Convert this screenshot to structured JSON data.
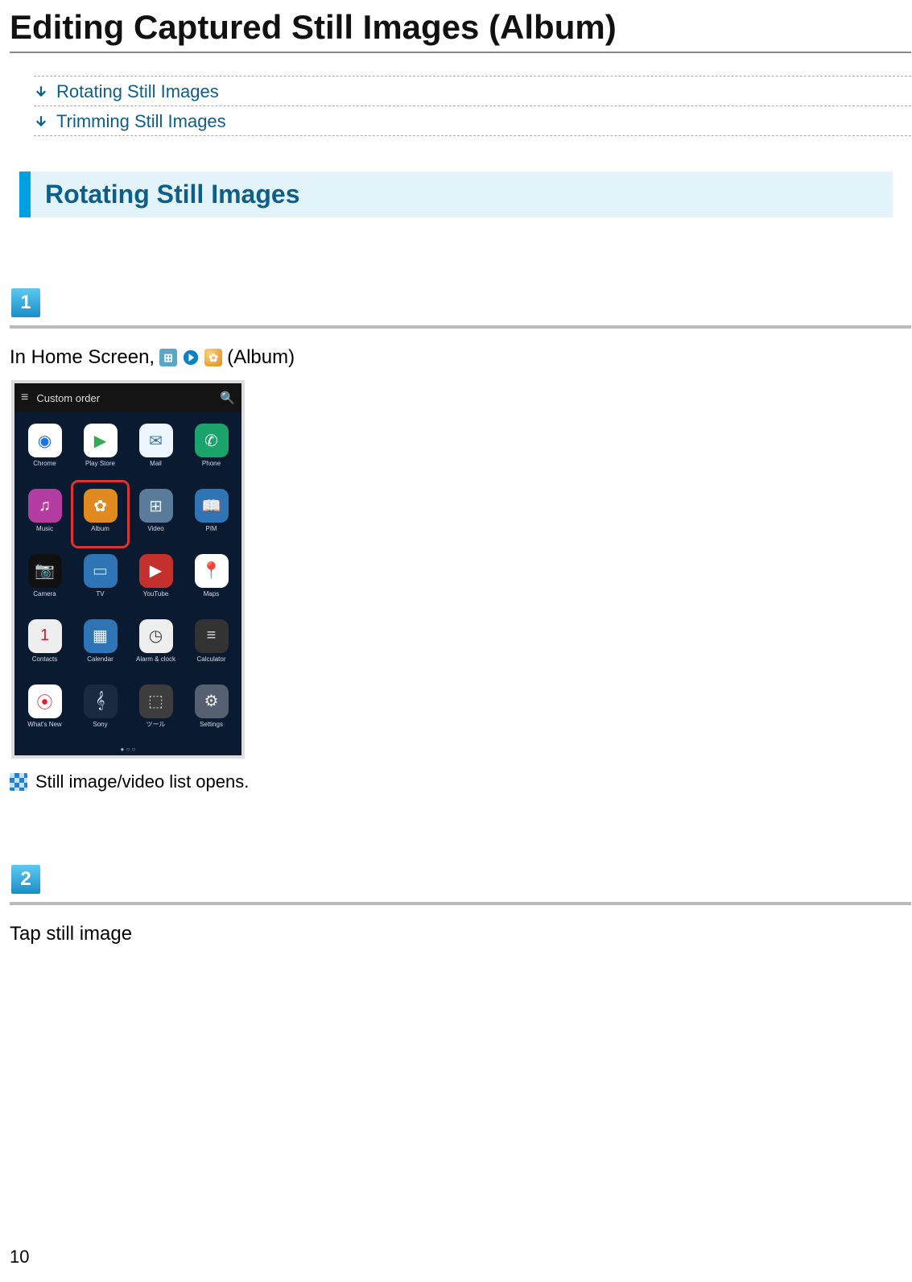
{
  "page_title": "Editing Captured Still Images (Album)",
  "toc": [
    {
      "label": "Rotating Still Images"
    },
    {
      "label": "Trimming Still Images"
    }
  ],
  "section_heading": "Rotating Still Images",
  "steps": [
    {
      "number": "1",
      "body_prefix": "In Home Screen,",
      "body_suffix": "(Album)",
      "result": "Still image/video list opens."
    },
    {
      "number": "2",
      "body": "Tap still image"
    }
  ],
  "phone": {
    "topbar_label": "Custom order",
    "apps": [
      {
        "label": "Chrome",
        "bg": "#ffffff",
        "glyph": "◉",
        "fg": "#1a73e8"
      },
      {
        "label": "Play Store",
        "bg": "#ffffff",
        "glyph": "▶",
        "fg": "#34a853"
      },
      {
        "label": "Mail",
        "bg": "#ecf6ff",
        "glyph": "✉",
        "fg": "#3d6eaa"
      },
      {
        "label": "Phone",
        "bg": "#1aa36b",
        "glyph": "✆",
        "fg": "#ffffff"
      },
      {
        "label": "Music",
        "bg": "#b43da3",
        "glyph": "♫",
        "fg": "#ffffff"
      },
      {
        "label": "Album",
        "bg": "#e08a1f",
        "glyph": "✿",
        "fg": "#ffffff",
        "highlight": true
      },
      {
        "label": "Video",
        "bg": "#5a7c9a",
        "glyph": "⊞",
        "fg": "#e9f3ff"
      },
      {
        "label": "PIM",
        "bg": "#2f74b5",
        "glyph": "📖",
        "fg": "#ffffff"
      },
      {
        "label": "Camera",
        "bg": "#111111",
        "glyph": "📷",
        "fg": "#eeeeee"
      },
      {
        "label": "TV",
        "bg": "#2f74b5",
        "glyph": "▭",
        "fg": "#bfe2ff"
      },
      {
        "label": "YouTube",
        "bg": "#c4302b",
        "glyph": "▶",
        "fg": "#ffffff"
      },
      {
        "label": "Maps",
        "bg": "#ffffff",
        "glyph": "📍",
        "fg": "#cc3333"
      },
      {
        "label": "Contacts",
        "bg": "#eeeeee",
        "glyph": "1",
        "fg": "#c23"
      },
      {
        "label": "Calendar",
        "bg": "#2f74b5",
        "glyph": "▦",
        "fg": "#ffffff"
      },
      {
        "label": "Alarm & clock",
        "bg": "#eeeeee",
        "glyph": "◷",
        "fg": "#444444"
      },
      {
        "label": "Calculator",
        "bg": "#333333",
        "glyph": "≡",
        "fg": "#dddddd"
      },
      {
        "label": "What's New",
        "bg": "#ffffff",
        "glyph": "⦿",
        "fg": "#d23"
      },
      {
        "label": "Sony",
        "bg": "#1a2a40",
        "glyph": "𝄞",
        "fg": "#cfe3f7"
      },
      {
        "label": "ツール",
        "bg": "#3d3d3d",
        "glyph": "⬚",
        "fg": "#cccccc"
      },
      {
        "label": "Settings",
        "bg": "#556070",
        "glyph": "⚙",
        "fg": "#eeeeee"
      }
    ]
  },
  "page_number": "10"
}
